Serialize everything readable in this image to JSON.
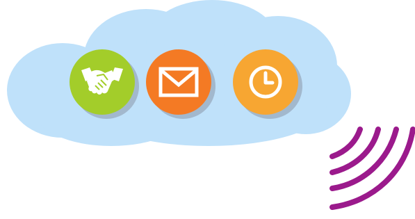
{
  "scene": {
    "cloud_color": "#bfe1fa",
    "signal_color": "#9b1a8c"
  },
  "icons": [
    {
      "name": "handshake-icon",
      "background": "#a3cd2a"
    },
    {
      "name": "mail-icon",
      "background": "#f47a24"
    },
    {
      "name": "clock-icon",
      "background": "#f7a632"
    }
  ]
}
